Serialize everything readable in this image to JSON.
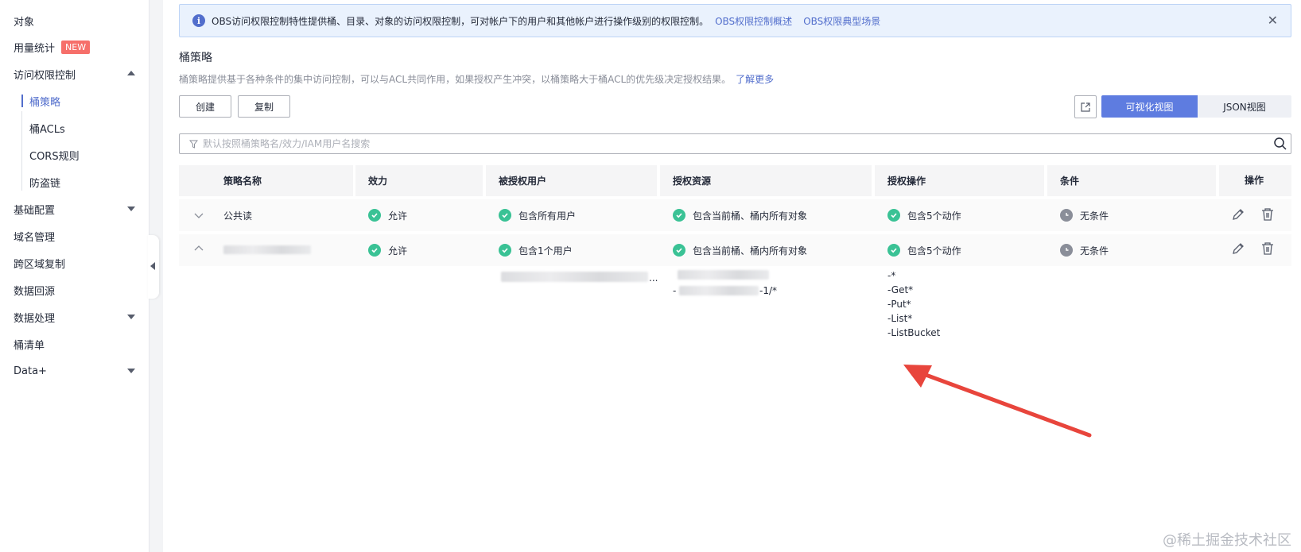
{
  "sidebar": {
    "items": [
      {
        "label": "对象",
        "name": "sidebar-item-objects"
      },
      {
        "label": "用量统计",
        "badge": "NEW",
        "name": "sidebar-item-usage"
      },
      {
        "label": "访问权限控制",
        "name": "sidebar-item-access-control"
      },
      {
        "label": "桶策略",
        "name": "sidebar-item-bucket-policy"
      },
      {
        "label": "桶ACLs",
        "name": "sidebar-item-bucket-acls"
      },
      {
        "label": "CORS规则",
        "name": "sidebar-item-cors"
      },
      {
        "label": "防盗链",
        "name": "sidebar-item-hotlink"
      },
      {
        "label": "基础配置",
        "name": "sidebar-item-basic-config"
      },
      {
        "label": "域名管理",
        "name": "sidebar-item-domain"
      },
      {
        "label": "跨区域复制",
        "name": "sidebar-item-cross-region"
      },
      {
        "label": "数据回源",
        "name": "sidebar-item-back-to-source"
      },
      {
        "label": "数据处理",
        "name": "sidebar-item-data-processing"
      },
      {
        "label": "桶清单",
        "name": "sidebar-item-inventory"
      },
      {
        "label": "Data+",
        "name": "sidebar-item-data-plus"
      }
    ]
  },
  "info": {
    "text": "OBS访问权限控制特性提供桶、目录、对象的访问权限控制，可对帐户下的用户和其他帐户进行操作级别的权限控制。",
    "link1": "OBS权限控制概述",
    "link2": "OBS权限典型场景"
  },
  "section": {
    "title": "桶策略",
    "desc": "桶策略提供基于各种条件的集中访问控制，可以与ACL共同作用，如果授权产生冲突，以桶策略大于桶ACL的优先级决定授权结果。",
    "learn_more": "了解更多"
  },
  "toolbar": {
    "create": "创建",
    "copy": "复制",
    "visual_view": "可视化视图",
    "json_view": "JSON视图"
  },
  "search": {
    "placeholder": "默认按照桶策略名/效力/IAM用户名搜索"
  },
  "table": {
    "headers": [
      "策略名称",
      "效力",
      "被授权用户",
      "授权资源",
      "授权操作",
      "条件",
      "操作"
    ],
    "rows": [
      {
        "name": "公共读",
        "effect": "允许",
        "principal": "包含所有用户",
        "resource": "包含当前桶、桶内所有对象",
        "action": "包含5个动作",
        "condition": "无条件"
      },
      {
        "name": "",
        "effect": "允许",
        "principal": "包含1个用户",
        "resource": "包含当前桶、桶内所有对象",
        "action": "包含5个动作",
        "condition": "无条件"
      }
    ],
    "expanded": {
      "principal_ellipsis": "...",
      "resource_prefix": "-",
      "resource_suffix": "-1/*",
      "actions": [
        "-*",
        "-Get*",
        "-Put*",
        "-List*",
        "-ListBucket"
      ]
    }
  },
  "watermark": "@稀土掘金技术社区",
  "colors": {
    "accent": "#5e7ce0",
    "link": "#526ecc",
    "success": "#3ac295",
    "annotation_arrow": "#e8453c"
  }
}
